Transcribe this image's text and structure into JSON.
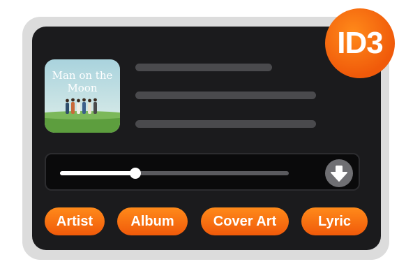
{
  "badge": {
    "label": "ID3"
  },
  "album": {
    "cover_title_line1": "Man on the",
    "cover_title_line2": "Moon"
  },
  "player": {
    "progress": 0.33,
    "download_icon": "arrow-down-icon"
  },
  "tags": [
    {
      "label": "Artist"
    },
    {
      "label": "Album"
    },
    {
      "label": "Cover Art"
    },
    {
      "label": "Lyric"
    }
  ],
  "colors": {
    "accent": "#f26b0f",
    "panel": "#1b1b1d",
    "frame": "#dcdcdc",
    "placeholder": "#4a4a4d"
  }
}
